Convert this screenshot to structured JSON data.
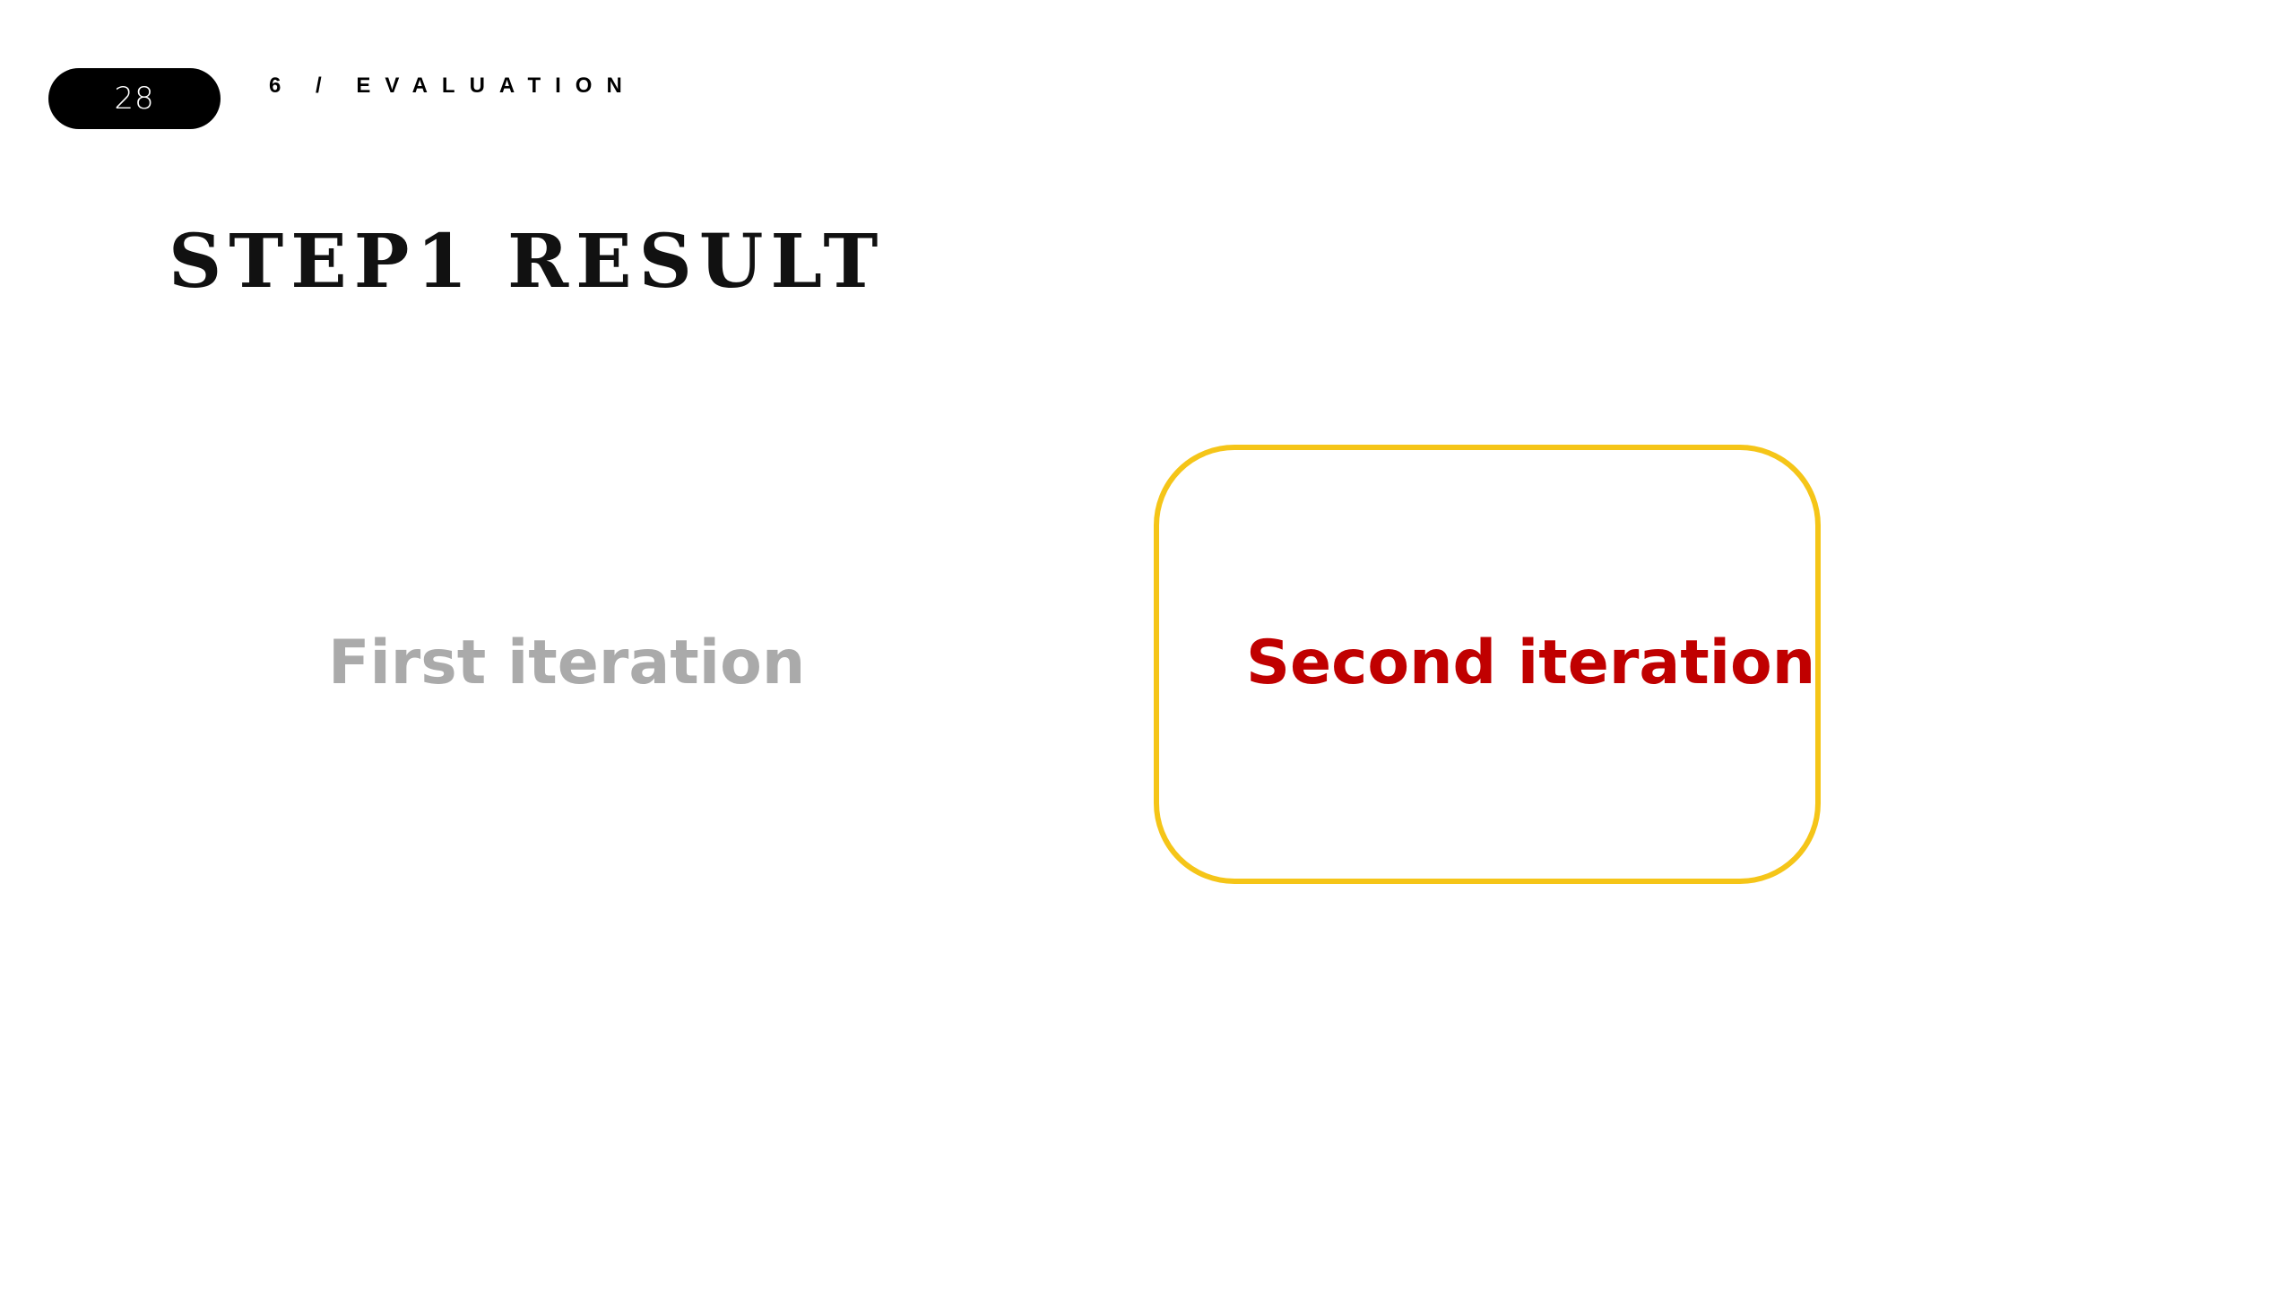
{
  "header": {
    "page_number": "28",
    "section_label": "6 / EVALUATION"
  },
  "slide": {
    "title": "STEP1 RESULT",
    "first_label": "First iteration",
    "second_label": "Second iteration"
  },
  "colors": {
    "pill_background": "#000000",
    "first_text": "#aaaaaa",
    "second_text": "#c00000",
    "highlight_border": "#f5c518"
  }
}
